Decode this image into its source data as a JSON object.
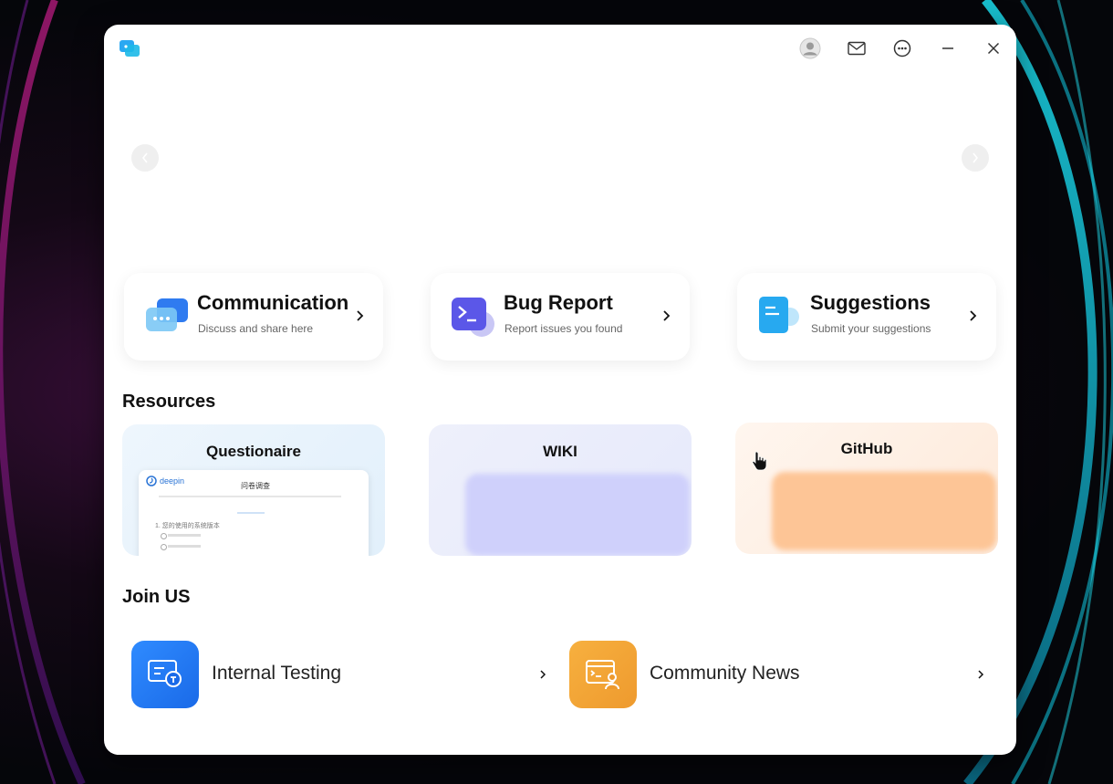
{
  "banner": {
    "prev_icon": "chevron-left-icon",
    "next_icon": "chevron-right-icon"
  },
  "titlebar": {
    "icons": [
      "avatar-icon",
      "mail-icon",
      "more-icon",
      "minimize-icon",
      "close-icon"
    ]
  },
  "features": [
    {
      "title": "Communication",
      "subtitle": "Discuss and share here",
      "icon": "chat-bubbles-icon",
      "color": "#2f7bf0"
    },
    {
      "title": "Bug Report",
      "subtitle": "Report issues you found",
      "icon": "terminal-icon",
      "color": "#5b57e8"
    },
    {
      "title": "Suggestions",
      "subtitle": "Submit your suggestions",
      "icon": "document-icon",
      "color": "#27a9f0"
    }
  ],
  "resources": {
    "title": "Resources",
    "items": [
      {
        "title": "Questionaire",
        "preview_logo": "deepin",
        "preview_heading": "问卷调查",
        "preview_item": "1. 您的使用的系统版本"
      },
      {
        "title": "WIKI"
      },
      {
        "title": "GitHub"
      }
    ]
  },
  "join": {
    "title": "Join US",
    "items": [
      {
        "label": "Internal Testing",
        "icon": "internal-testing-icon",
        "color": "#1a73f5"
      },
      {
        "label": "Community News",
        "icon": "community-news-icon",
        "color": "#f2a23a"
      }
    ]
  }
}
